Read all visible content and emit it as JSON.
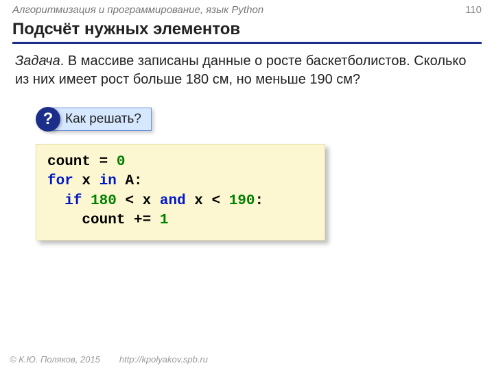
{
  "header": {
    "course": "Алгоритмизация и программирование, язык Python",
    "page": "110"
  },
  "title": "Подсчёт нужных элементов",
  "task": {
    "label": "Задача",
    "text": ". В массиве записаны данные о росте баскетболистов. Сколько из них имеет рост больше 180 см, но меньше 190 см?"
  },
  "hint": {
    "mark": "?",
    "label": "Как решать?"
  },
  "code": {
    "t_count": "count",
    "t_eq": " = ",
    "n0": "0",
    "k_for": "for",
    "t_x": " x ",
    "k_in": "in",
    "t_A": " A:",
    "k_if": "if",
    "sp1": " ",
    "n180": "180",
    "t_ltx": " < x ",
    "k_and": "and",
    "t_xlt": " x < ",
    "n190": "190",
    "t_colon": ":",
    "t_inc": "count += ",
    "n1": "1"
  },
  "footer": {
    "copyright": "© К.Ю. Поляков, 2015",
    "url": "http://kpolyakov.spb.ru"
  }
}
